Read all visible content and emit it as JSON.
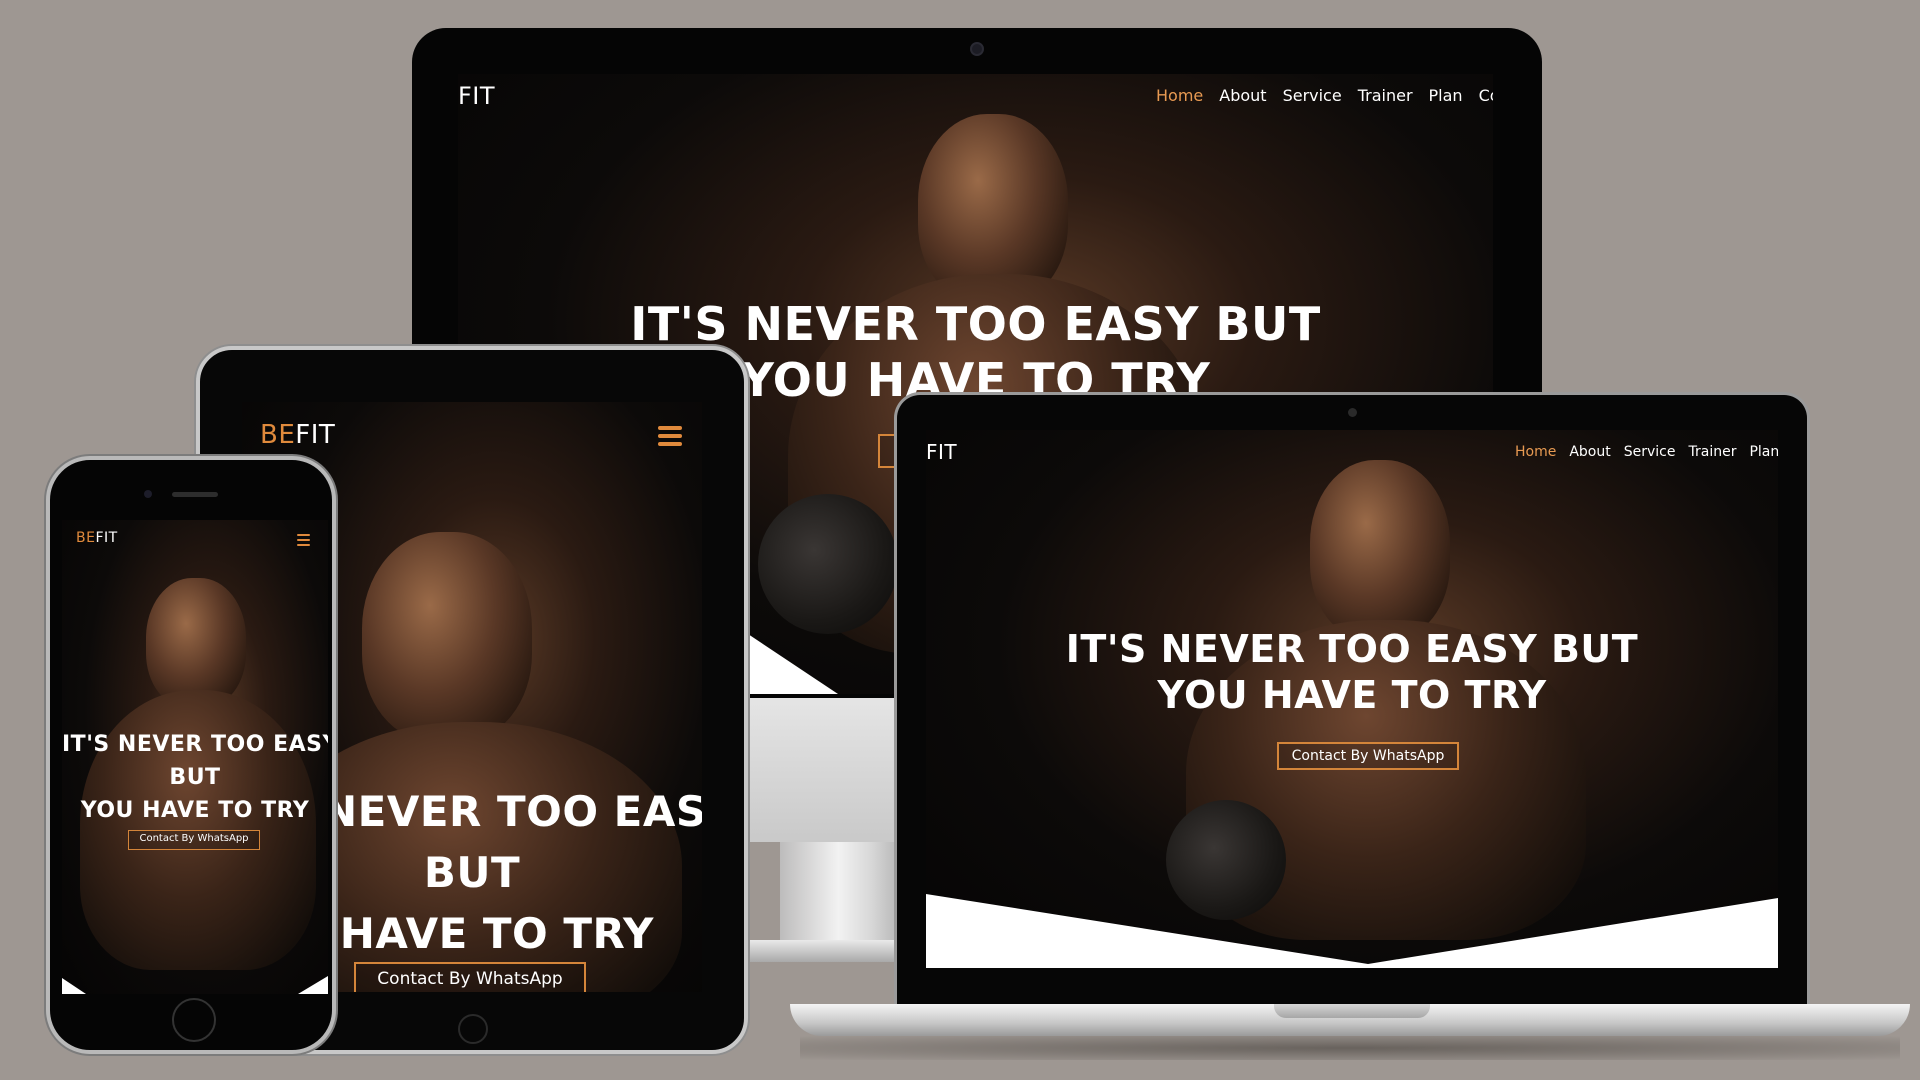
{
  "brand": {
    "be": "BE",
    "fit": "FIT"
  },
  "nav": {
    "home": "Home",
    "about": "About",
    "service": "Service",
    "trainer": "Trainer",
    "plan": "Plan",
    "contact_partial": "Cor"
  },
  "hero": {
    "line1": "IT'S NEVER TOO EASY BUT",
    "line2": "YOU HAVE TO TRY",
    "tablet_line1": "NEVER TOO EASY",
    "tablet_line2": "BUT",
    "tablet_line3": "U HAVE TO TRY",
    "phone_line1": "IT'S NEVER TOO EASY",
    "phone_line2": "BUT",
    "phone_line3": "YOU HAVE TO TRY",
    "cta": "Contact By WhatsApp"
  },
  "colors": {
    "background": "#9e9792",
    "accent": "#e08a3c",
    "active_link": "#e89a52",
    "text": "#ffffff"
  },
  "icons": [
    "hamburger-menu-icon",
    "camera-icon",
    "home-button-icon"
  ]
}
